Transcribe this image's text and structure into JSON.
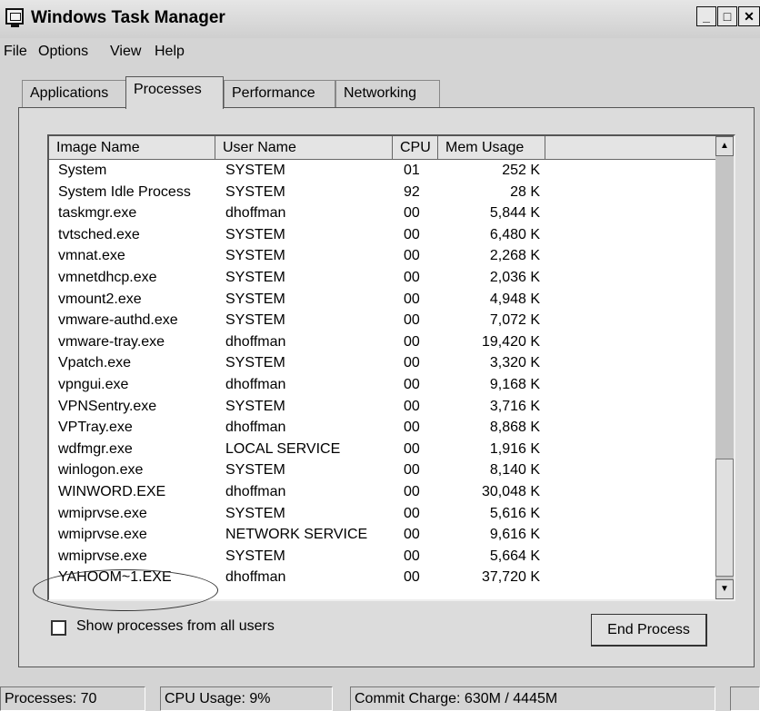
{
  "window": {
    "title": "Windows Task Manager",
    "buttons": {
      "minimize": "_",
      "maximize": "□",
      "close": "✕"
    }
  },
  "menu": [
    "File",
    "Options",
    "View",
    "Help"
  ],
  "tabs": [
    {
      "label": "Applications",
      "active": false
    },
    {
      "label": "Processes",
      "active": true
    },
    {
      "label": "Performance",
      "active": false
    },
    {
      "label": "Networking",
      "active": false
    }
  ],
  "columns": [
    "Image Name",
    "User Name",
    "CPU",
    "Mem Usage"
  ],
  "processes": [
    {
      "name": "System",
      "user": "SYSTEM",
      "cpu": "01",
      "mem": "252 K"
    },
    {
      "name": "System Idle Process",
      "user": "SYSTEM",
      "cpu": "92",
      "mem": "28 K"
    },
    {
      "name": "taskmgr.exe",
      "user": "dhoffman",
      "cpu": "00",
      "mem": "5,844 K"
    },
    {
      "name": "tvtsched.exe",
      "user": "SYSTEM",
      "cpu": "00",
      "mem": "6,480 K"
    },
    {
      "name": "vmnat.exe",
      "user": "SYSTEM",
      "cpu": "00",
      "mem": "2,268 K"
    },
    {
      "name": "vmnetdhcp.exe",
      "user": "SYSTEM",
      "cpu": "00",
      "mem": "2,036 K"
    },
    {
      "name": "vmount2.exe",
      "user": "SYSTEM",
      "cpu": "00",
      "mem": "4,948 K"
    },
    {
      "name": "vmware-authd.exe",
      "user": "SYSTEM",
      "cpu": "00",
      "mem": "7,072 K"
    },
    {
      "name": "vmware-tray.exe",
      "user": "dhoffman",
      "cpu": "00",
      "mem": "19,420 K"
    },
    {
      "name": "Vpatch.exe",
      "user": "SYSTEM",
      "cpu": "00",
      "mem": "3,320 K"
    },
    {
      "name": "vpngui.exe",
      "user": "dhoffman",
      "cpu": "00",
      "mem": "9,168 K"
    },
    {
      "name": "VPNSentry.exe",
      "user": "SYSTEM",
      "cpu": "00",
      "mem": "3,716 K"
    },
    {
      "name": "VPTray.exe",
      "user": "dhoffman",
      "cpu": "00",
      "mem": "8,868 K"
    },
    {
      "name": "wdfmgr.exe",
      "user": "LOCAL SERVICE",
      "cpu": "00",
      "mem": "1,916 K"
    },
    {
      "name": "winlogon.exe",
      "user": "SYSTEM",
      "cpu": "00",
      "mem": "8,140 K"
    },
    {
      "name": "WINWORD.EXE",
      "user": "dhoffman",
      "cpu": "00",
      "mem": "30,048 K"
    },
    {
      "name": "wmiprvse.exe",
      "user": "SYSTEM",
      "cpu": "00",
      "mem": "5,616 K"
    },
    {
      "name": "wmiprvse.exe",
      "user": "NETWORK SERVICE",
      "cpu": "00",
      "mem": "9,616 K"
    },
    {
      "name": "wmiprvse.exe",
      "user": "SYSTEM",
      "cpu": "00",
      "mem": "5,664 K"
    },
    {
      "name": "YAHOOM~1.EXE",
      "user": "dhoffman",
      "cpu": "00",
      "mem": "37,720 K"
    }
  ],
  "scrollbar": {
    "up_icon": "▲",
    "down_icon": "▼"
  },
  "show_all_users_label": "Show processes from all users",
  "show_all_users_checked": false,
  "end_process_label": "End Process",
  "status": {
    "processes": "Processes: 70",
    "cpu": "CPU Usage: 9%",
    "commit": "Commit Charge: 630M / 4445M"
  }
}
